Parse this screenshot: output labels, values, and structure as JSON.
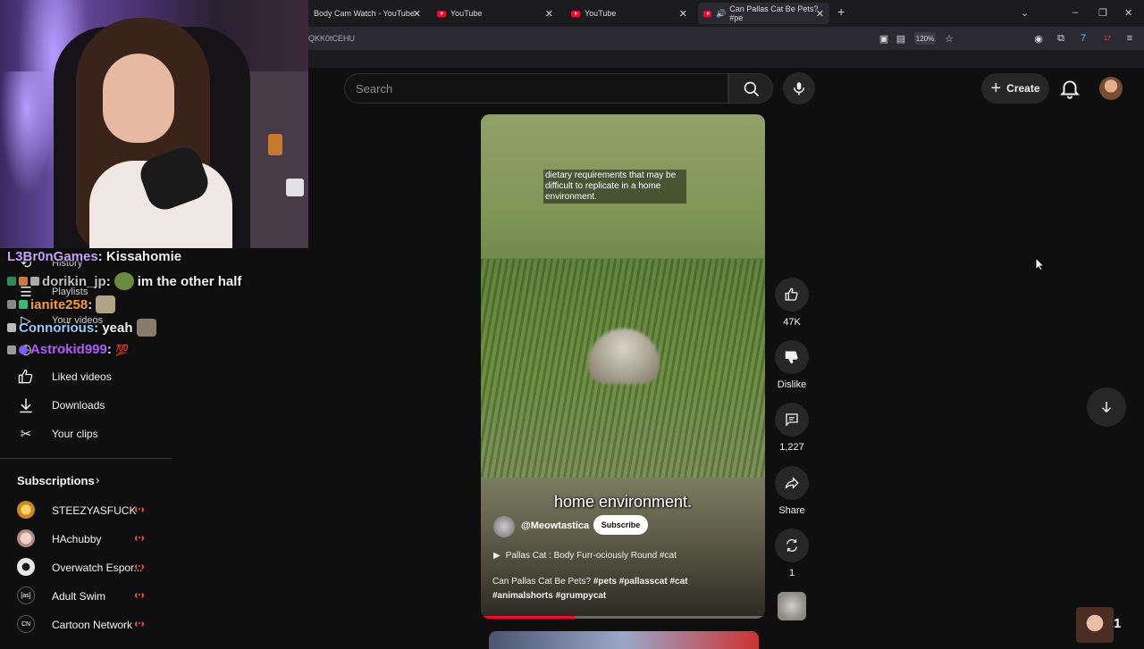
{
  "browser": {
    "tabs": [
      {
        "title": "Body Cam Watch - YouTube"
      },
      {
        "title": "YouTube"
      },
      {
        "title": "YouTube"
      },
      {
        "title": "Can Pallas Cat Be Pets? #pe"
      }
    ],
    "url_fragment": "QKK0tCEHU",
    "zoom": "120%",
    "ext_badge": "17"
  },
  "header": {
    "search_placeholder": "Search",
    "create_label": "Create"
  },
  "sidebar": {
    "items": [
      {
        "label": "History",
        "icon": "history-icon"
      },
      {
        "label": "Playlists",
        "icon": "playlists-icon"
      },
      {
        "label": "Your videos",
        "icon": "your-videos-icon"
      },
      {
        "label": "Watch later",
        "icon": "watch-later-icon"
      },
      {
        "label": "Liked videos",
        "icon": "thumbs-up-icon"
      },
      {
        "label": "Downloads",
        "icon": "download-icon"
      },
      {
        "label": "Your clips",
        "icon": "scissors-icon"
      }
    ],
    "subscriptions_title": "Subscriptions",
    "subscriptions": [
      {
        "name": "STEEZYASFUCK"
      },
      {
        "name": "HAchubby"
      },
      {
        "name": "Overwatch Espor..."
      },
      {
        "name": "Adult Swim"
      },
      {
        "name": "Cartoon Network"
      }
    ]
  },
  "chat": [
    {
      "user": "L3Br0nGames",
      "user_color": "#c9a4ff",
      "message": "Kissahomie"
    },
    {
      "user": "dorikin_jp",
      "user_color": "#c0c0c0",
      "message": "im the other half"
    },
    {
      "user": "ianite258",
      "user_color": "#ff9f2e",
      "message": ""
    },
    {
      "user": "Connorious",
      "user_color": "#9ec9ff",
      "message": "yeah"
    },
    {
      "user": "Astrokid999",
      "user_color": "#b65cff",
      "message": "💯"
    }
  ],
  "short": {
    "caption_top": "dietary requirements that may be difficult to replicate in a home environment.",
    "caption_bottom": "home environment.",
    "channel": "@Meowtastica",
    "subscribe_label": "Subscribe",
    "playlist": "Pallas Cat : Body Furr-ociously Round #cat",
    "title_plain": "Can Pallas Cat Be Pets?",
    "hashtags_line1": "#pets #pallasscat #cat",
    "hashtags_line2": "#animalshorts #grumpycat",
    "progress": 0.33
  },
  "actions": {
    "likes": "47K",
    "dislike_label": "Dislike",
    "comments": "1,227",
    "share_label": "Share",
    "remix_count": "1"
  },
  "corner_count": "1"
}
